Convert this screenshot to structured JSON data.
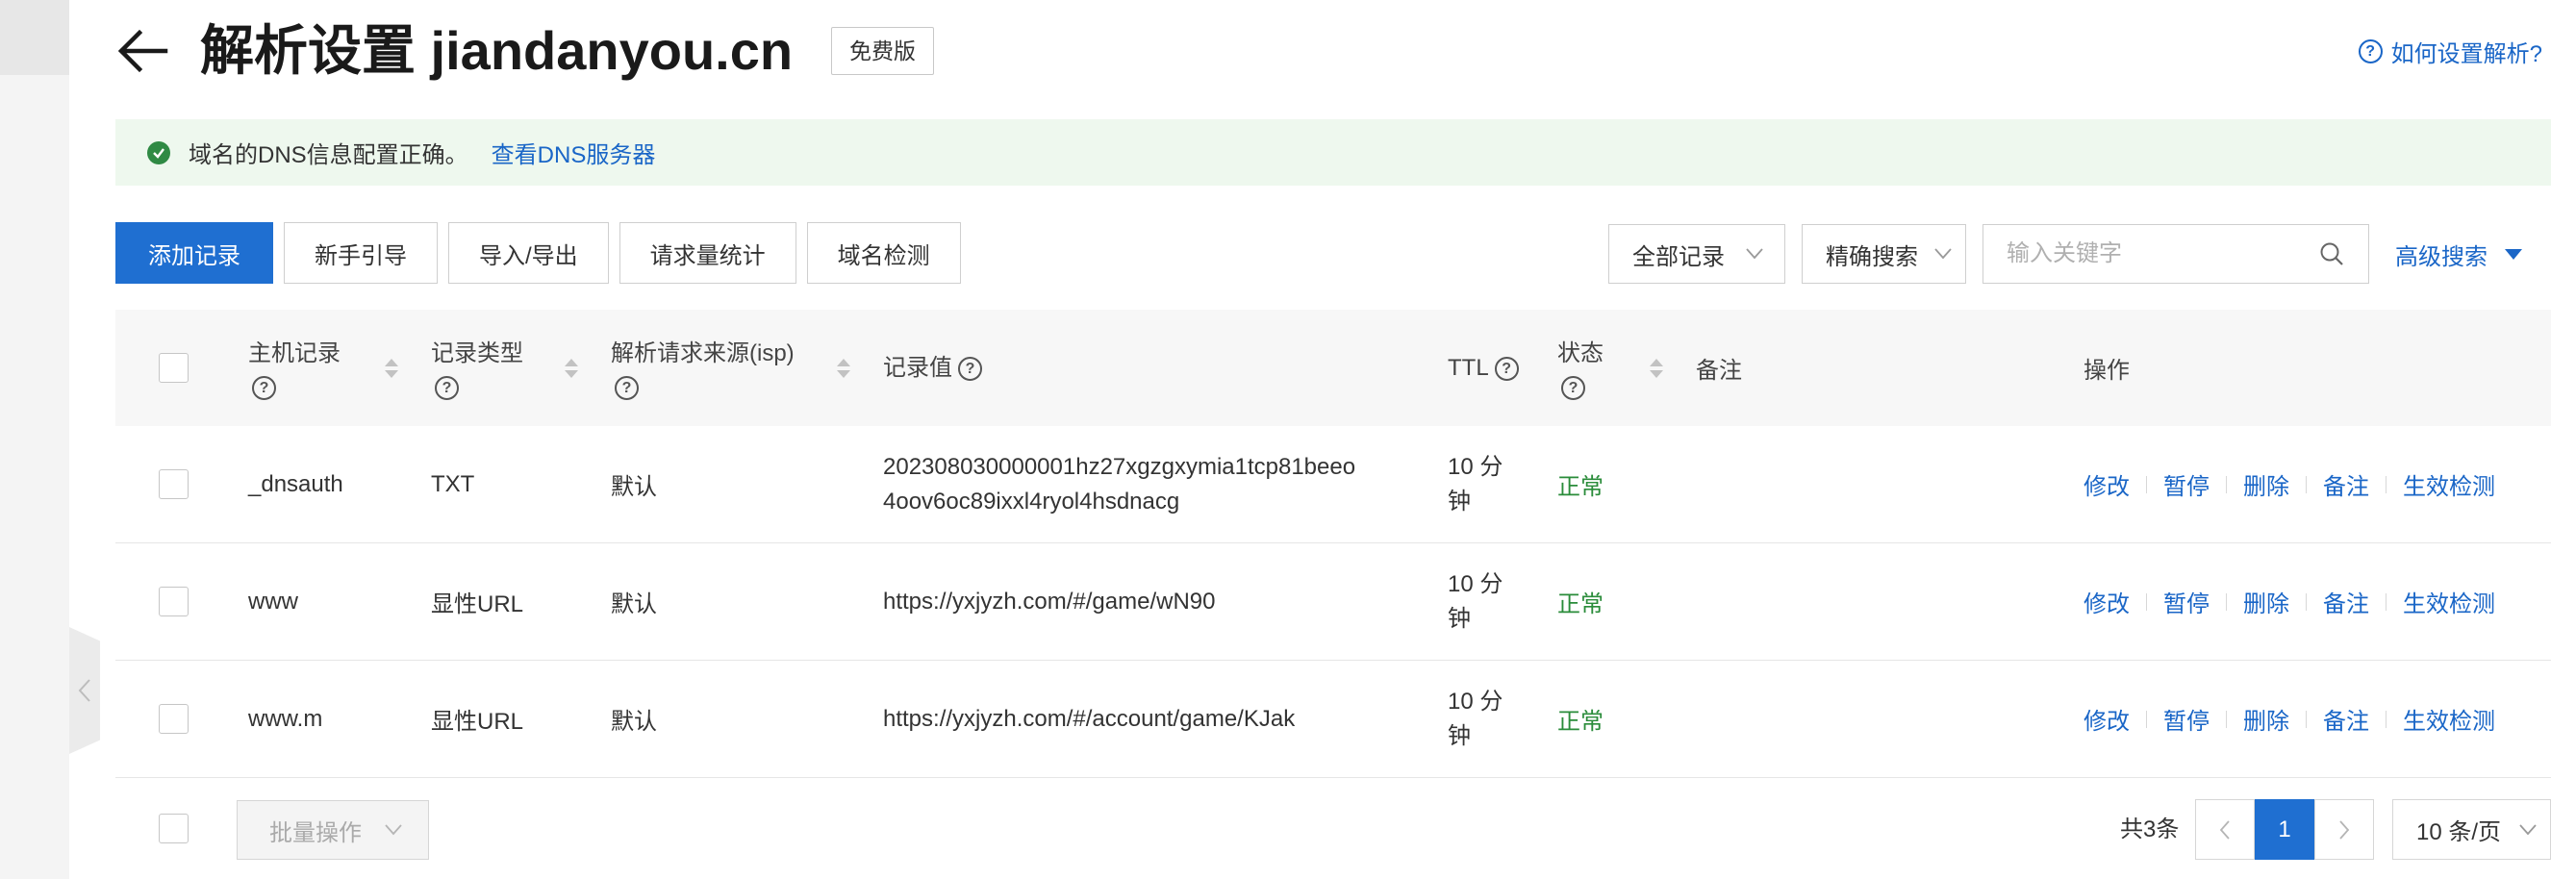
{
  "page": {
    "title": "解析设置 jiandanyou.cn",
    "edition_badge": "免费版",
    "help_link": "如何设置解析?"
  },
  "alert": {
    "message": "域名的DNS信息配置正确。",
    "link": "查看DNS服务器"
  },
  "toolbar": {
    "buttons": [
      "添加记录",
      "新手引导",
      "导入/导出",
      "请求量统计",
      "域名检测"
    ],
    "record_filter": "全部记录",
    "search_mode": "精确搜索",
    "search_placeholder": "输入关键字",
    "advanced_search": "高级搜索"
  },
  "table": {
    "headers": {
      "host": "主机记录",
      "type": "记录类型",
      "isp": "解析请求来源(isp)",
      "value": "记录值",
      "ttl": "TTL",
      "status": "状态",
      "remark": "备注",
      "actions": "操作"
    },
    "rows": [
      {
        "host": "_dnsauth",
        "type": "TXT",
        "isp": "默认",
        "value": "202308030000001hz27xgzgxymia1tcp81beeo4oov6oc89ixxl4ryol4hsdnacg",
        "ttl": "10 分钟",
        "status": "正常"
      },
      {
        "host": "www",
        "type": "显性URL",
        "isp": "默认",
        "value": "https://yxjyzh.com/#/game/wN90",
        "ttl": "10 分钟",
        "status": "正常"
      },
      {
        "host": "www.m",
        "type": "显性URL",
        "isp": "默认",
        "value": "https://yxjyzh.com/#/account/game/KJak",
        "ttl": "10 分钟",
        "status": "正常"
      }
    ],
    "row_actions": [
      "修改",
      "暂停",
      "删除",
      "备注",
      "生效检测"
    ]
  },
  "footer": {
    "batch_action": "批量操作",
    "total": "共3条",
    "current_page": "1",
    "page_size": "10 条/页"
  },
  "icons": {
    "back": "arrow-left-icon",
    "help": "question-circle-icon",
    "alert": "check-circle-icon",
    "search": "search-icon",
    "dropdown": "chevron-down-icon",
    "advanced_search": "caret-down-icon",
    "sort": "sort-icon",
    "sidebar_toggle": "chevron-left-icon",
    "prev_page": "chevron-left-icon",
    "next_page": "chevron-right-icon"
  },
  "colors": {
    "primary": "#1f6fd1",
    "link": "#1a66c7",
    "success": "#2a8c3a",
    "alert_bg": "#eef8ee"
  }
}
